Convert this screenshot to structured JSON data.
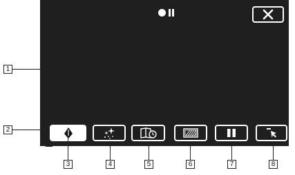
{
  "status": {
    "record_icon": "record-dot-icon",
    "pause_icon": "pause-indicator-icon"
  },
  "close_button": {
    "icon": "close-icon"
  },
  "toolbar": {
    "buttons": [
      {
        "name": "pen-tool-button",
        "icon": "pen-icon",
        "selected": true
      },
      {
        "name": "sparkle-effect-button",
        "icon": "sparkle-icon",
        "selected": false
      },
      {
        "name": "book-timer-button",
        "icon": "book-clock-icon",
        "selected": false
      },
      {
        "name": "screen-pattern-button",
        "icon": "hatched-screen-icon",
        "selected": false
      },
      {
        "name": "pause-button",
        "icon": "pause-icon",
        "selected": false
      },
      {
        "name": "cursor-button",
        "icon": "cursor-arrow-icon",
        "selected": false
      }
    ]
  },
  "callouts": {
    "c1": "1",
    "c2": "2",
    "c3": "3",
    "c4": "4",
    "c5": "5",
    "c6": "6",
    "c7": "7",
    "c8": "8"
  },
  "colors": {
    "screen_bg": "#1f1f1f",
    "icon": "#ffffff",
    "callout_line": "#222222"
  }
}
